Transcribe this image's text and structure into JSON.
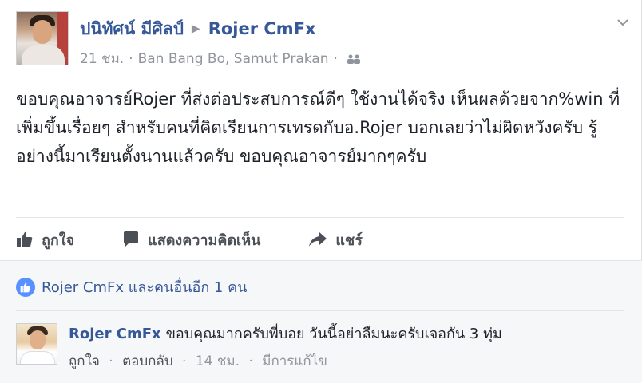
{
  "post": {
    "author": "ปนิทัศน์ มีศิลป์",
    "target_page": "Rojer CmFx",
    "time": "21 ชม.",
    "location": "Ban Bang Bo, Samut Prakan",
    "audience_icon": "friends-icon",
    "text": "ขอบคุณอาจารย์Rojer ที่ส่งต่อประสบการณ์ดีๆ ใช้งานได้จริง เห็นผลด้วยจาก%win ที่เพิ่มขึ้นเรื่อยๆ สำหรับคนที่คิดเรียนการเทรดกับอ.Rojer บอกเลยว่าไม่ผิดหวังครับ รู้อย่างนี้มาเรียนตั้งนานแล้วครับ ขอบคุณอาจารย์มากๆครับ"
  },
  "actions": {
    "like": "ถูกใจ",
    "comment": "แสดงความคิดเห็น",
    "share": "แชร์"
  },
  "likes_summary": "Rojer CmFx และคนอื่นอีก 1 คน",
  "comment": {
    "author": "Rojer CmFx",
    "text": "ขอบคุณมากครับพี่บอย วันนี้อย่าลืมนะครับเจอกัน 3 ทุ่ม",
    "like_label": "ถูกใจ",
    "reply_label": "ตอบกลับ",
    "time": "14 ชม.",
    "edited": "มีการแก้ไข"
  },
  "colors": {
    "link_blue": "#365899",
    "meta_gray": "#90949c",
    "like_badge": "#5890ff"
  }
}
